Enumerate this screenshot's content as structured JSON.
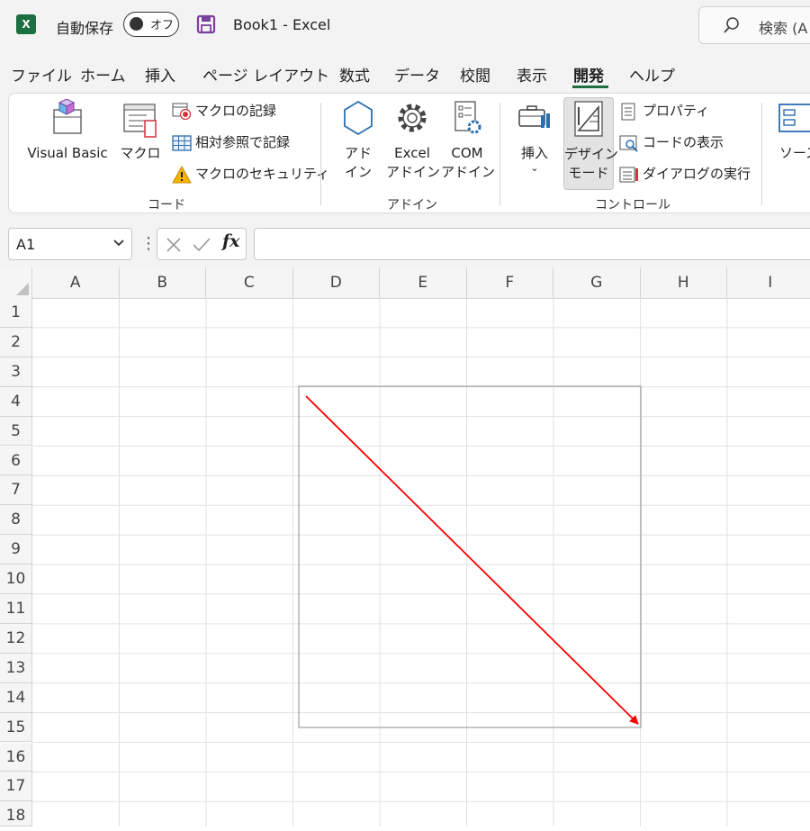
{
  "titlebar": {
    "app_icon": "excel-icon",
    "autosave_label": "自動保存",
    "autosave_toggle": "オフ",
    "save_icon": "save-icon",
    "title": "Book1  -  Excel",
    "search_placeholder": "検索 (A"
  },
  "menu": {
    "tabs": [
      {
        "label": "ファイル"
      },
      {
        "label": "ホーム"
      },
      {
        "label": "挿入"
      },
      {
        "label": "ページ レイアウト"
      },
      {
        "label": "数式"
      },
      {
        "label": "データ"
      },
      {
        "label": "校閲"
      },
      {
        "label": "表示"
      },
      {
        "label": "開発"
      },
      {
        "label": "ヘルプ"
      }
    ],
    "active": "開発"
  },
  "ribbon": {
    "code": {
      "visual_basic": "Visual Basic",
      "macro": "マクロ",
      "record_macro": "マクロの記録",
      "relative_ref": "相対参照で記録",
      "macro_security": "マクロのセキュリティ",
      "group_label": "コード"
    },
    "addins": {
      "addin_line1": "アド",
      "addin_line2": "イン",
      "excel_addin_line1": "Excel",
      "excel_addin_line2": "アドイン",
      "com_addin_line1": "COM",
      "com_addin_line2": "アドイン",
      "group_label": "アドイン"
    },
    "controls": {
      "insert": "挿入",
      "design_mode_line1": "デザイン",
      "design_mode_line2": "モード",
      "properties": "プロパティ",
      "view_code": "コードの表示",
      "run_dialog": "ダイアログの実行",
      "group_label": "コントロール"
    },
    "source": {
      "label": "ソース"
    }
  },
  "formula_bar": {
    "name_box": "A1",
    "fx": "fx",
    "value": ""
  },
  "sheet": {
    "columns": [
      "A",
      "B",
      "C",
      "D",
      "E",
      "F",
      "G",
      "H",
      "I"
    ],
    "rows": [
      "1",
      "2",
      "3",
      "4",
      "5",
      "6",
      "7",
      "8",
      "9",
      "10",
      "11",
      "12",
      "13",
      "14",
      "15",
      "16",
      "17",
      "18"
    ],
    "shapes": {
      "rectangle_outline": "#a6a6a6",
      "arrow_color": "#ff0000"
    }
  }
}
